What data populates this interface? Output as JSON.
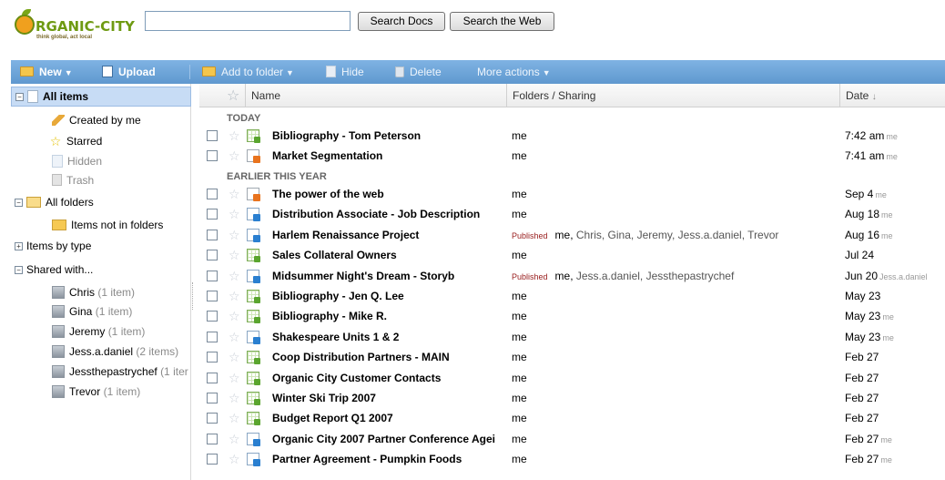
{
  "header": {
    "logo_text": "RGANIC-CITY",
    "logo_letter": "O",
    "tagline": "think global, act local",
    "search_value": "",
    "search_docs_label": "Search Docs",
    "search_web_label": "Search the Web"
  },
  "toolbar": {
    "new_label": "New",
    "upload_label": "Upload",
    "add_to_folder_label": "Add to folder",
    "hide_label": "Hide",
    "delete_label": "Delete",
    "more_actions_label": "More actions"
  },
  "sidebar": {
    "all_items": "All items",
    "created_by_me": "Created by me",
    "starred": "Starred",
    "hidden": "Hidden",
    "trash": "Trash",
    "all_folders": "All folders",
    "items_not_in_folders": "Items not in folders",
    "items_by_type": "Items by type",
    "shared_with": "Shared with...",
    "people": [
      {
        "name": "Chris",
        "count": "(1 item)"
      },
      {
        "name": "Gina",
        "count": "(1 item)"
      },
      {
        "name": "Jeremy",
        "count": "(1 item)"
      },
      {
        "name": "Jess.a.daniel",
        "count": "(2 items)"
      },
      {
        "name": "Jessthepastrychef",
        "count": "(1 iter"
      },
      {
        "name": "Trevor",
        "count": "(1 item)"
      }
    ]
  },
  "grid": {
    "columns": {
      "name": "Name",
      "sharing": "Folders / Sharing",
      "date": "Date",
      "date_sort": "↓"
    },
    "groups": [
      "TODAY",
      "EARLIER THIS YEAR"
    ],
    "published_label": "Published",
    "rows": [
      {
        "name": "Bibliography - Tom Peterson",
        "sharing": "me",
        "people": "",
        "date": "7:42 am",
        "who": "me",
        "type": "sheet",
        "published": false
      },
      {
        "name": "Market Segmentation",
        "sharing": "me",
        "people": "",
        "date": "7:41 am",
        "who": "me",
        "type": "pres",
        "published": false
      },
      {
        "name": "The power of the web",
        "sharing": "me",
        "people": "",
        "date": "Sep 4",
        "who": "me",
        "type": "pres",
        "published": false
      },
      {
        "name": "Distribution Associate - Job Description",
        "sharing": "me",
        "people": "",
        "date": "Aug 18",
        "who": "me",
        "type": "doc",
        "published": false
      },
      {
        "name": "Harlem Renaissance Project",
        "sharing": "me,",
        "people": "Chris, Gina, Jeremy, Jess.a.daniel, Trevor",
        "date": "Aug 16",
        "who": "me",
        "type": "doc",
        "published": true
      },
      {
        "name": "Sales Collateral Owners",
        "sharing": "me",
        "people": "",
        "date": "Jul 24",
        "who": "",
        "type": "sheet",
        "published": false
      },
      {
        "name": "Midsummer Night's Dream - Storyb",
        "sharing": "me,",
        "people": "Jess.a.daniel, Jessthepastrychef",
        "date": "Jun 20",
        "who": "Jess.a.daniel",
        "type": "doc",
        "published": true
      },
      {
        "name": "Bibliography - Jen Q. Lee",
        "sharing": "me",
        "people": "",
        "date": "May 23",
        "who": "",
        "type": "sheet",
        "published": false
      },
      {
        "name": "Bibliography - Mike R.",
        "sharing": "me",
        "people": "",
        "date": "May 23",
        "who": "me",
        "type": "sheet",
        "published": false
      },
      {
        "name": "Shakespeare Units 1 & 2",
        "sharing": "me",
        "people": "",
        "date": "May 23",
        "who": "me",
        "type": "doc",
        "published": false
      },
      {
        "name": "Coop Distribution Partners - MAIN",
        "sharing": "me",
        "people": "",
        "date": "Feb 27",
        "who": "",
        "type": "sheet",
        "published": false
      },
      {
        "name": "Organic City Customer Contacts",
        "sharing": "me",
        "people": "",
        "date": "Feb 27",
        "who": "",
        "type": "sheet",
        "published": false
      },
      {
        "name": "Winter Ski Trip 2007",
        "sharing": "me",
        "people": "",
        "date": "Feb 27",
        "who": "",
        "type": "sheet",
        "published": false
      },
      {
        "name": "Budget Report Q1 2007",
        "sharing": "me",
        "people": "",
        "date": "Feb 27",
        "who": "",
        "type": "sheet",
        "published": false
      },
      {
        "name": "Organic City 2007 Partner Conference Agei",
        "sharing": "me",
        "people": "",
        "date": "Feb 27",
        "who": "me",
        "type": "doc",
        "published": false
      },
      {
        "name": "Partner Agreement - Pumpkin Foods",
        "sharing": "me",
        "people": "",
        "date": "Feb 27",
        "who": "me",
        "type": "doc",
        "published": false
      }
    ]
  }
}
